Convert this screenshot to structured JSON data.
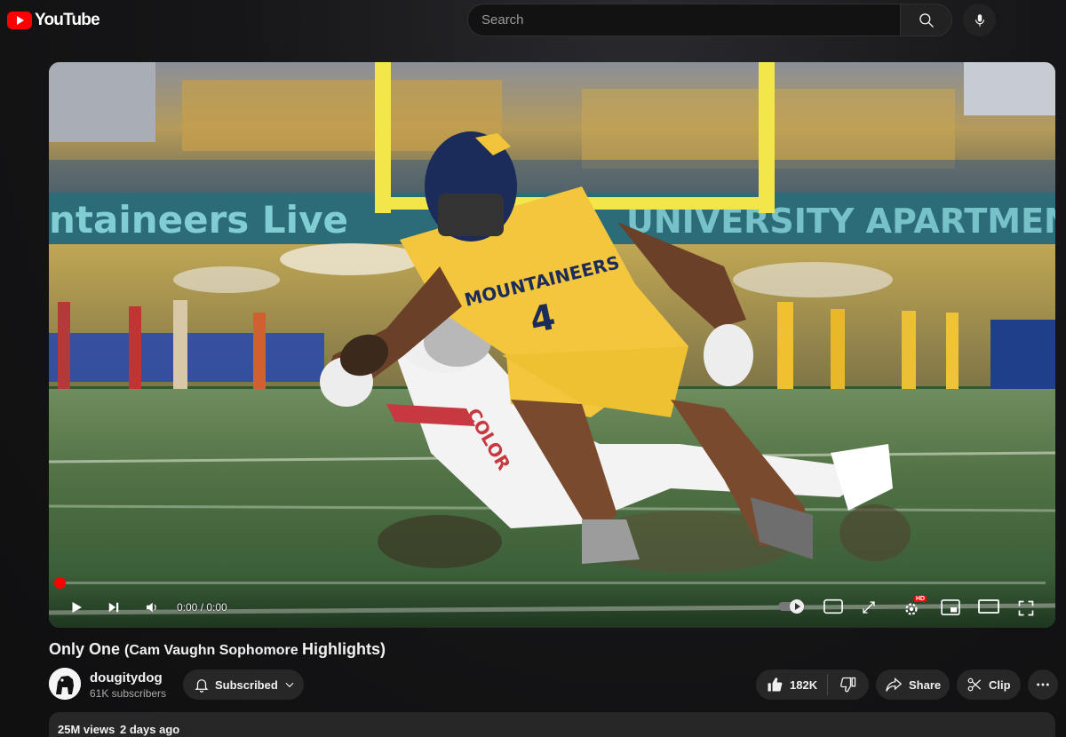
{
  "header": {
    "logo_text": "YouTube",
    "search_placeholder": "Search"
  },
  "player": {
    "banner_left": "ntaineers Live",
    "banner_right": "UNIVERSITY APARTMENTS",
    "jersey_text": "MOUNTAINEERS",
    "jersey_number": "4",
    "opponent_text": "COLOR",
    "time_display": "0:00 / 0:00",
    "progress": 0,
    "hd_badge": "HD",
    "cc_label": "CC"
  },
  "video": {
    "title_main": "Only One ",
    "title_paren": "(Cam Vaughn Sophomore ",
    "title_end": "Highlights)",
    "channel_name": "dougitydog",
    "subscribers": "61K subscribers",
    "subscribe_label": "Subscribed",
    "likes": "182K",
    "share_label": "Share",
    "clip_label": "Clip",
    "views": "25M views",
    "date": "2 days ago"
  },
  "colors": {
    "brand_red": "#ff0000",
    "jersey_gold": "#f4c63d",
    "navy": "#1b2b5a"
  }
}
